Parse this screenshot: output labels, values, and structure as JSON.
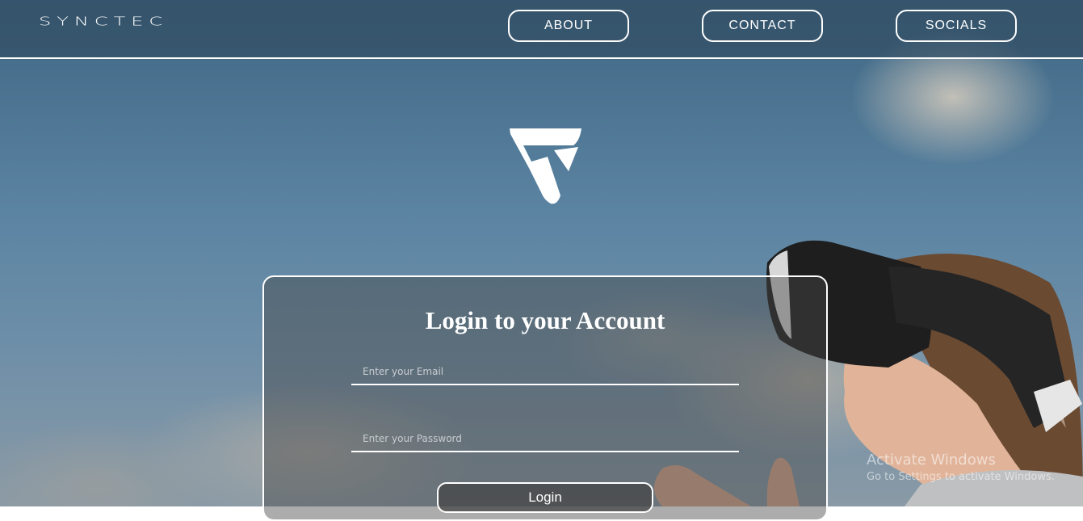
{
  "header": {
    "brand": "SYNCTEC",
    "nav": [
      {
        "label": "ABOUT"
      },
      {
        "label": "CONTACT"
      },
      {
        "label": "SOCIALS"
      }
    ]
  },
  "login": {
    "title": "Login to your Account",
    "email_placeholder": "Enter your Email",
    "email_value": "",
    "password_placeholder": "Enter your Password",
    "password_value": "",
    "submit_label": "Login"
  },
  "watermark": {
    "title": "Activate Windows",
    "subtitle": "Go to Settings to activate Windows."
  },
  "icons": {
    "logo": "synctec-logo-icon"
  },
  "colors": {
    "nav_border": "#ffffff",
    "text": "#ffffff",
    "header_bg": "#324e64"
  }
}
